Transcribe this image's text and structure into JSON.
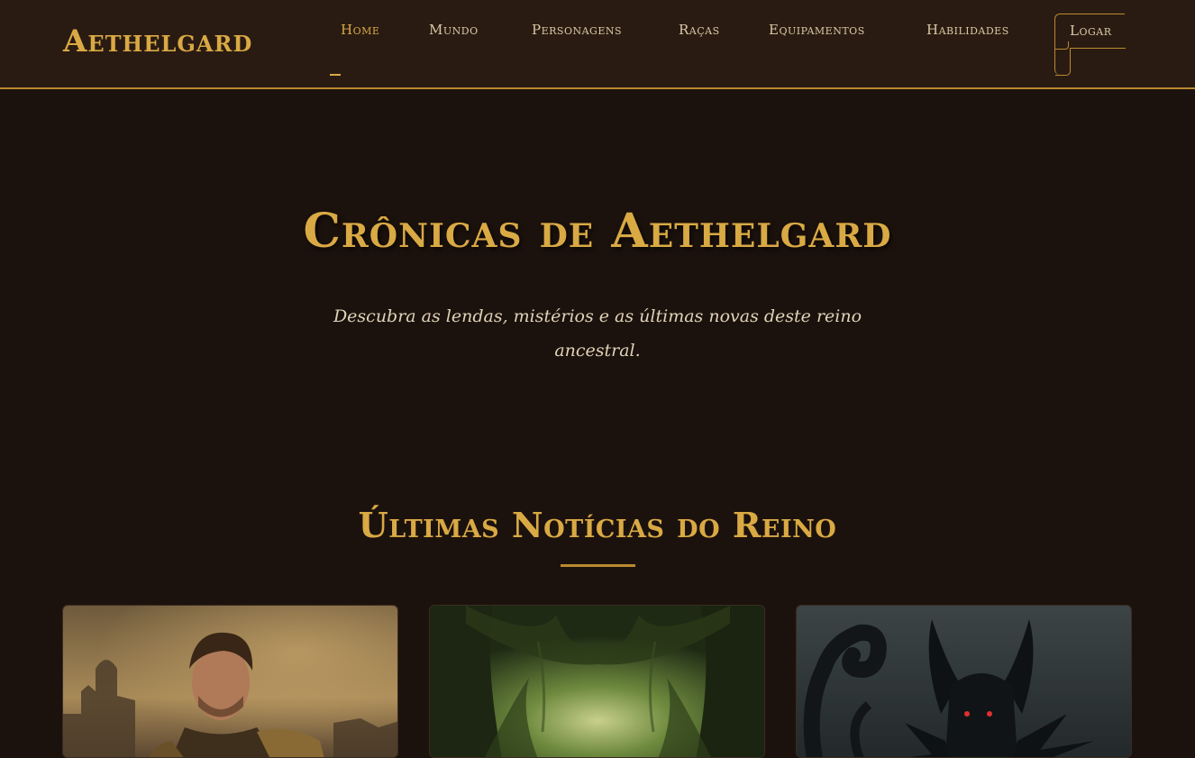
{
  "header": {
    "logo": "Aethelgard",
    "nav": [
      {
        "label": "Home",
        "active": true
      },
      {
        "label": "Mundo",
        "active": false
      },
      {
        "label": "Personagens",
        "active": false
      },
      {
        "label": "Raças",
        "active": false
      },
      {
        "label": "Equipamentos",
        "active": false
      },
      {
        "label": "Habilidades",
        "active": false
      }
    ],
    "login_label": "Logar"
  },
  "hero": {
    "title": "Crônicas de Aethelgard",
    "subtitle": "Descubra as lendas, mistérios e as últimas novas deste reino ancestral."
  },
  "news": {
    "section_title": "Últimas Notícias do Reino",
    "cards": [
      {
        "image": "armored-warrior-portrait"
      },
      {
        "image": "enchanted-forest"
      },
      {
        "image": "shadow-demon"
      }
    ]
  },
  "colors": {
    "background": "#1c120d",
    "header": "#2a1b12",
    "accent_gold": "#d9a944",
    "text_light": "#e0d3b8"
  }
}
